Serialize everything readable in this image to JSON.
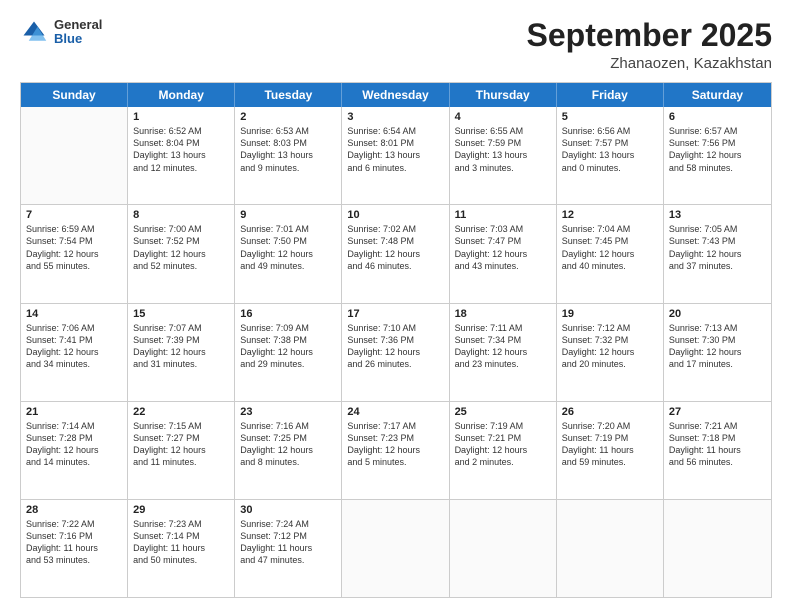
{
  "header": {
    "logo_general": "General",
    "logo_blue": "Blue",
    "month_title": "September 2025",
    "location": "Zhanaozen, Kazakhstan"
  },
  "weekdays": [
    "Sunday",
    "Monday",
    "Tuesday",
    "Wednesday",
    "Thursday",
    "Friday",
    "Saturday"
  ],
  "rows": [
    [
      {
        "day": "",
        "text": ""
      },
      {
        "day": "1",
        "text": "Sunrise: 6:52 AM\nSunset: 8:04 PM\nDaylight: 13 hours\nand 12 minutes."
      },
      {
        "day": "2",
        "text": "Sunrise: 6:53 AM\nSunset: 8:03 PM\nDaylight: 13 hours\nand 9 minutes."
      },
      {
        "day": "3",
        "text": "Sunrise: 6:54 AM\nSunset: 8:01 PM\nDaylight: 13 hours\nand 6 minutes."
      },
      {
        "day": "4",
        "text": "Sunrise: 6:55 AM\nSunset: 7:59 PM\nDaylight: 13 hours\nand 3 minutes."
      },
      {
        "day": "5",
        "text": "Sunrise: 6:56 AM\nSunset: 7:57 PM\nDaylight: 13 hours\nand 0 minutes."
      },
      {
        "day": "6",
        "text": "Sunrise: 6:57 AM\nSunset: 7:56 PM\nDaylight: 12 hours\nand 58 minutes."
      }
    ],
    [
      {
        "day": "7",
        "text": "Sunrise: 6:59 AM\nSunset: 7:54 PM\nDaylight: 12 hours\nand 55 minutes."
      },
      {
        "day": "8",
        "text": "Sunrise: 7:00 AM\nSunset: 7:52 PM\nDaylight: 12 hours\nand 52 minutes."
      },
      {
        "day": "9",
        "text": "Sunrise: 7:01 AM\nSunset: 7:50 PM\nDaylight: 12 hours\nand 49 minutes."
      },
      {
        "day": "10",
        "text": "Sunrise: 7:02 AM\nSunset: 7:48 PM\nDaylight: 12 hours\nand 46 minutes."
      },
      {
        "day": "11",
        "text": "Sunrise: 7:03 AM\nSunset: 7:47 PM\nDaylight: 12 hours\nand 43 minutes."
      },
      {
        "day": "12",
        "text": "Sunrise: 7:04 AM\nSunset: 7:45 PM\nDaylight: 12 hours\nand 40 minutes."
      },
      {
        "day": "13",
        "text": "Sunrise: 7:05 AM\nSunset: 7:43 PM\nDaylight: 12 hours\nand 37 minutes."
      }
    ],
    [
      {
        "day": "14",
        "text": "Sunrise: 7:06 AM\nSunset: 7:41 PM\nDaylight: 12 hours\nand 34 minutes."
      },
      {
        "day": "15",
        "text": "Sunrise: 7:07 AM\nSunset: 7:39 PM\nDaylight: 12 hours\nand 31 minutes."
      },
      {
        "day": "16",
        "text": "Sunrise: 7:09 AM\nSunset: 7:38 PM\nDaylight: 12 hours\nand 29 minutes."
      },
      {
        "day": "17",
        "text": "Sunrise: 7:10 AM\nSunset: 7:36 PM\nDaylight: 12 hours\nand 26 minutes."
      },
      {
        "day": "18",
        "text": "Sunrise: 7:11 AM\nSunset: 7:34 PM\nDaylight: 12 hours\nand 23 minutes."
      },
      {
        "day": "19",
        "text": "Sunrise: 7:12 AM\nSunset: 7:32 PM\nDaylight: 12 hours\nand 20 minutes."
      },
      {
        "day": "20",
        "text": "Sunrise: 7:13 AM\nSunset: 7:30 PM\nDaylight: 12 hours\nand 17 minutes."
      }
    ],
    [
      {
        "day": "21",
        "text": "Sunrise: 7:14 AM\nSunset: 7:28 PM\nDaylight: 12 hours\nand 14 minutes."
      },
      {
        "day": "22",
        "text": "Sunrise: 7:15 AM\nSunset: 7:27 PM\nDaylight: 12 hours\nand 11 minutes."
      },
      {
        "day": "23",
        "text": "Sunrise: 7:16 AM\nSunset: 7:25 PM\nDaylight: 12 hours\nand 8 minutes."
      },
      {
        "day": "24",
        "text": "Sunrise: 7:17 AM\nSunset: 7:23 PM\nDaylight: 12 hours\nand 5 minutes."
      },
      {
        "day": "25",
        "text": "Sunrise: 7:19 AM\nSunset: 7:21 PM\nDaylight: 12 hours\nand 2 minutes."
      },
      {
        "day": "26",
        "text": "Sunrise: 7:20 AM\nSunset: 7:19 PM\nDaylight: 11 hours\nand 59 minutes."
      },
      {
        "day": "27",
        "text": "Sunrise: 7:21 AM\nSunset: 7:18 PM\nDaylight: 11 hours\nand 56 minutes."
      }
    ],
    [
      {
        "day": "28",
        "text": "Sunrise: 7:22 AM\nSunset: 7:16 PM\nDaylight: 11 hours\nand 53 minutes."
      },
      {
        "day": "29",
        "text": "Sunrise: 7:23 AM\nSunset: 7:14 PM\nDaylight: 11 hours\nand 50 minutes."
      },
      {
        "day": "30",
        "text": "Sunrise: 7:24 AM\nSunset: 7:12 PM\nDaylight: 11 hours\nand 47 minutes."
      },
      {
        "day": "",
        "text": ""
      },
      {
        "day": "",
        "text": ""
      },
      {
        "day": "",
        "text": ""
      },
      {
        "day": "",
        "text": ""
      }
    ]
  ]
}
